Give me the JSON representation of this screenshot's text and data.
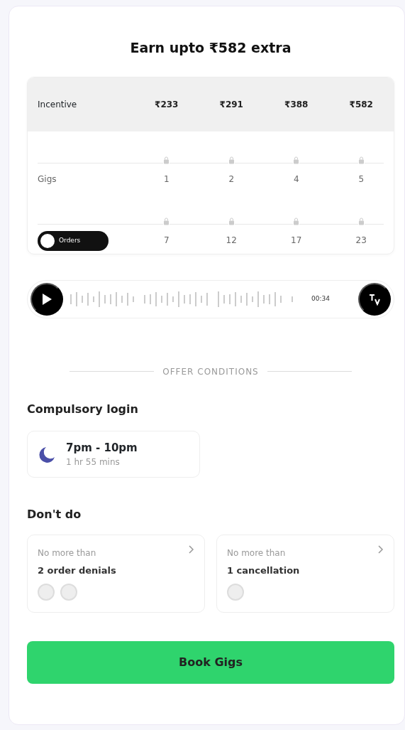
{
  "title": "Earn upto ₹582 extra",
  "table": {
    "header": {
      "label": "Incentive",
      "values": [
        "₹233",
        "₹291",
        "₹388",
        "₹582"
      ]
    },
    "rows": [
      {
        "kind": "label",
        "label": "Gigs",
        "values": [
          "1",
          "2",
          "4",
          "5"
        ]
      },
      {
        "kind": "toggle",
        "label": "Orders",
        "on": false,
        "values": [
          "7",
          "12",
          "17",
          "23"
        ]
      }
    ]
  },
  "audio": {
    "time": "00:34"
  },
  "section_title": "OFFER CONDITIONS",
  "compulsory_login": {
    "heading": "Compulsory login",
    "slot": {
      "time": "7pm - 10pm",
      "duration": "1 hr 55 mins"
    }
  },
  "dont_do": {
    "heading": "Don't do",
    "cards": [
      {
        "caption": "No more than",
        "text": "2 order denials",
        "badges": [
          {
            "kind": "coin"
          },
          {
            "kind": "coin"
          }
        ]
      },
      {
        "caption": "No more than",
        "text": "1 cancellation",
        "badges": [
          {
            "kind": "coin"
          }
        ]
      }
    ]
  },
  "button": "Book Gigs"
}
